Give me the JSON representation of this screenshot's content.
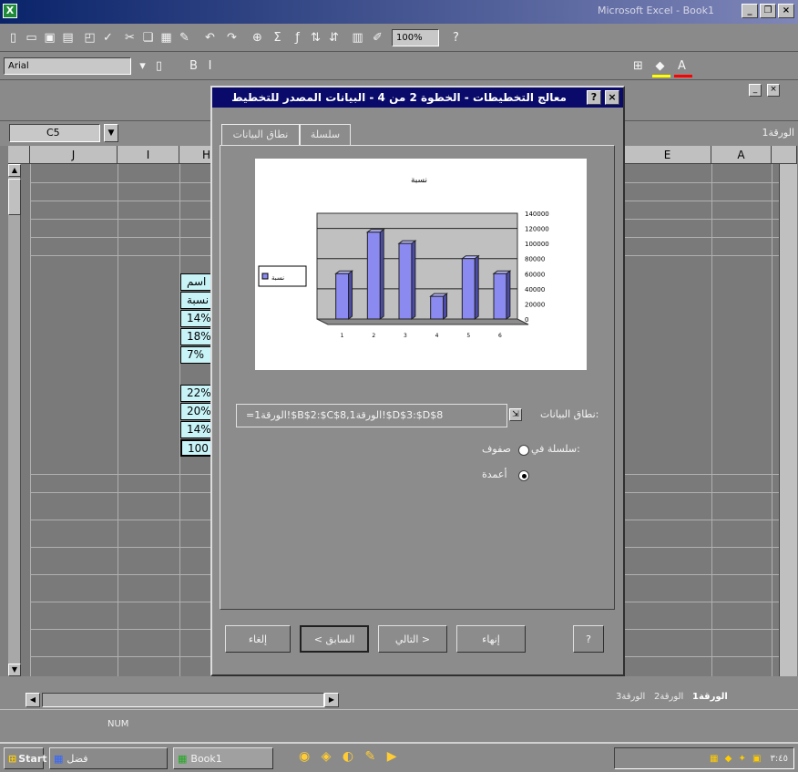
{
  "window": {
    "title": "Microsoft Excel - Book1",
    "close_glyph": "×"
  },
  "formula_bar": {
    "name_box": "C5",
    "font_name": "Arial",
    "zoom": "100%",
    "sheet_label": "الورقة1"
  },
  "columns": [
    "J",
    "I",
    "H",
    "E",
    "A"
  ],
  "cells": [
    "اسم",
    "نسبة",
    "14%",
    "18%",
    "7%",
    "22%",
    "20%",
    "14%",
    "100"
  ],
  "dialog": {
    "title": "معالج التخطيطات - الخطوة 2 من 4 - البيانات المصدر للتخطيط",
    "help_glyph": "?",
    "tabs": [
      "نطاق البيانات",
      "سلسلة"
    ],
    "range_label": "نطاق البيانات:",
    "range_value": "=الورقة1!$B$2:$C$8,الورقة1!$D$3:$D$8",
    "series_in_label": "سلسلة في:",
    "option_rows": "صفوف",
    "option_columns": "أعمدة",
    "buttons": {
      "cancel": "إلغاء",
      "back": "< السابق",
      "next": "التالي >",
      "finish": "إنهاء",
      "help": "?"
    },
    "legend_label": "نسبة"
  },
  "chart_data": {
    "type": "bar",
    "title": "نسبة",
    "categories": [
      "1",
      "2",
      "3",
      "4",
      "5",
      "6"
    ],
    "values": [
      60000,
      115000,
      100000,
      30000,
      80000,
      60000
    ],
    "ylim": [
      0,
      140000
    ],
    "ticks": [
      "0",
      "20000",
      "40000",
      "60000",
      "80000",
      "100000",
      "120000",
      "140000"
    ]
  },
  "status": {
    "mode": "NUM",
    "sheet_tabs": [
      "الورقة3",
      "الورقة2",
      "الورقة1"
    ]
  },
  "taskbar": {
    "start": "Start",
    "book1": "Book1",
    "doc": "فضل",
    "clock": "٣:٤٥"
  },
  "colors": {
    "bar": "#8a8af0",
    "title_bar": "#0a0a6a",
    "cell_highlight": "#c8f4f8"
  }
}
